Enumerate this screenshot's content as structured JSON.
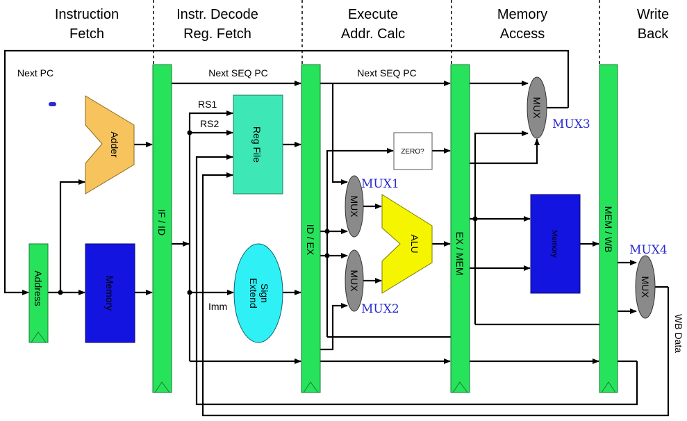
{
  "stages": [
    {
      "line1": "Instruction",
      "line2": "Fetch"
    },
    {
      "line1": "Instr. Decode",
      "line2": "Reg. Fetch"
    },
    {
      "line1": "Execute",
      "line2": "Addr. Calc"
    },
    {
      "line1": "Memory",
      "line2": "Access"
    },
    {
      "line1": "Write",
      "line2": "Back"
    }
  ],
  "pipeline_registers": [
    "IF / ID",
    "ID / EX",
    "EX / MEM",
    "MEM / WB"
  ],
  "blocks": {
    "address": "Address",
    "instr_memory": "Memory",
    "adder": "Adder",
    "reg_file": "Reg File",
    "sign_extend_1": "Sign",
    "sign_extend_2": "Extend",
    "zero": "ZERO?",
    "alu": "ALU",
    "data_memory": "Memory",
    "mux": "MUX"
  },
  "mux_names": [
    "MUX1",
    "MUX2",
    "MUX3",
    "MUX4"
  ],
  "signals": {
    "next_pc": "Next PC",
    "next_seq_pc": "Next SEQ PC",
    "rs1": "RS1",
    "rs2": "RS2",
    "imm": "Imm",
    "wb_data": "WB Data"
  },
  "colors": {
    "pipeline_register": "#27e35c",
    "memory": "#1414e0",
    "reg_file": "#3ee8b6",
    "sign_extend": "#2ff0f5",
    "adder": "#f7c35c",
    "alu": "#f5f500",
    "mux": "#8a8a8a",
    "mux_label": "#2a2ad0"
  }
}
